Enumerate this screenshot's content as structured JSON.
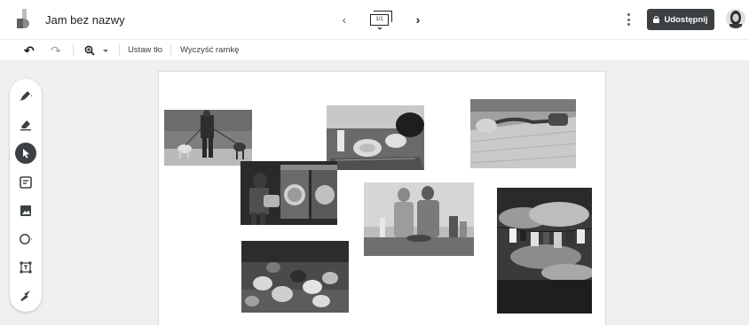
{
  "header": {
    "title": "Jam bez nazwy",
    "frame_indicator": "1/1",
    "share_label": "Udostępnij"
  },
  "toolbar": {
    "set_background_label": "Ustaw tło",
    "clear_frame_label": "Wyczyść ramkę"
  },
  "tools": [
    "pen-icon",
    "eraser-icon",
    "select-icon",
    "sticky-note-icon",
    "image-icon",
    "circle-icon",
    "text-box-icon",
    "laser-icon"
  ],
  "canvas": {
    "photos": [
      "people-walking-dogs",
      "person-with-laundry",
      "dishes-in-dishwasher",
      "couple-cooking",
      "vacuum-cleaning-floor",
      "laundry-on-clothesline",
      "chickens-feeding"
    ]
  },
  "colors": {
    "accent": "#3c4043",
    "workspace_bg": "#efefef"
  }
}
